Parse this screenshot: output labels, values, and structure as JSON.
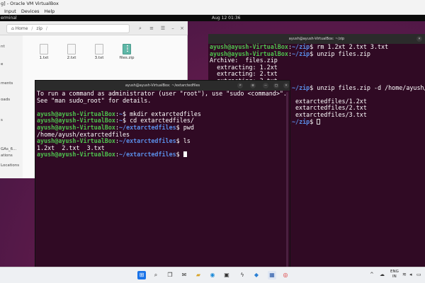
{
  "host": {
    "title": "g] - Oracle VM VirtualBox",
    "menu": [
      "Input",
      "Devices",
      "Help"
    ]
  },
  "guest_topbar": {
    "left": "erminal",
    "clock": "Aug 12  01:36"
  },
  "files": {
    "path_home": "Home",
    "path_folder": "zip",
    "sidebar": [
      "nt",
      "e",
      "ments",
      "oads",
      "",
      "s",
      "",
      "GAs_6...",
      "ations",
      "Locations"
    ],
    "items": [
      {
        "name": "1.txt",
        "type": "text"
      },
      {
        "name": "2.txt",
        "type": "text"
      },
      {
        "name": "3.txt",
        "type": "text"
      },
      {
        "name": "files.zip",
        "type": "zip"
      }
    ]
  },
  "term_back": {
    "title": "ayush@ayush-VirtualBox: ~/zip",
    "lines": [
      {
        "user": "ayush@ayush-VirtualBox",
        "path": "~/zip",
        "cmd": "rm 1.2xt 2.txt 3.txt"
      },
      {
        "user": "ayush@ayush-VirtualBox",
        "path": "~/zip",
        "cmd": "unzip files.zip"
      },
      {
        "text": "Archive:  files.zip"
      },
      {
        "text": "  extracting: 1.2xt"
      },
      {
        "text": "  extracting: 2.txt"
      },
      {
        "text": "  extracting: 3.txt"
      },
      {
        "user": "ayush@ayush-VirtualBox",
        "path": "~/zip",
        "cmd": "unzip files.zip -d /home/ayush/extarcted"
      },
      {
        "text": ""
      },
      {
        "text": "                        extarctedfiles/1.2xt"
      },
      {
        "text": "                        extarctedfiles/2.txt"
      },
      {
        "text": "                        extarctedfiles/3.txt"
      },
      {
        "user": "ayush@ayush-VirtualBox",
        "path": "~/zip",
        "cmd": "",
        "cursor": true
      }
    ]
  },
  "term_front": {
    "title": "ayush@ayush-VirtualBox: ~/extarctedfiles",
    "lines": [
      {
        "text": "To run a command as administrator (user \"root\"), use \"sudo <command>\"."
      },
      {
        "text": "See \"man sudo_root\" for details."
      },
      {
        "text": ""
      },
      {
        "user": "ayush@ayush-VirtualBox",
        "path": "~",
        "cmd": "mkdir extarctedfiles"
      },
      {
        "user": "ayush@ayush-VirtualBox",
        "path": "~",
        "cmd": "cd extarctedfiles/"
      },
      {
        "user": "ayush@ayush-VirtualBox",
        "path": "~/extarctedfiles",
        "cmd": "pwd"
      },
      {
        "text": "/home/ayush/extarctedfiles"
      },
      {
        "user": "ayush@ayush-VirtualBox",
        "path": "~/extarctedfiles",
        "cmd": "ls"
      },
      {
        "text": "1.2xt  2.txt  3.txt"
      },
      {
        "user": "ayush@ayush-VirtualBox",
        "path": "~/extarctedfiles",
        "cmd": "",
        "cursor": true
      }
    ]
  },
  "taskbar": {
    "lang_top": "ENG",
    "lang_bottom": "IN"
  }
}
